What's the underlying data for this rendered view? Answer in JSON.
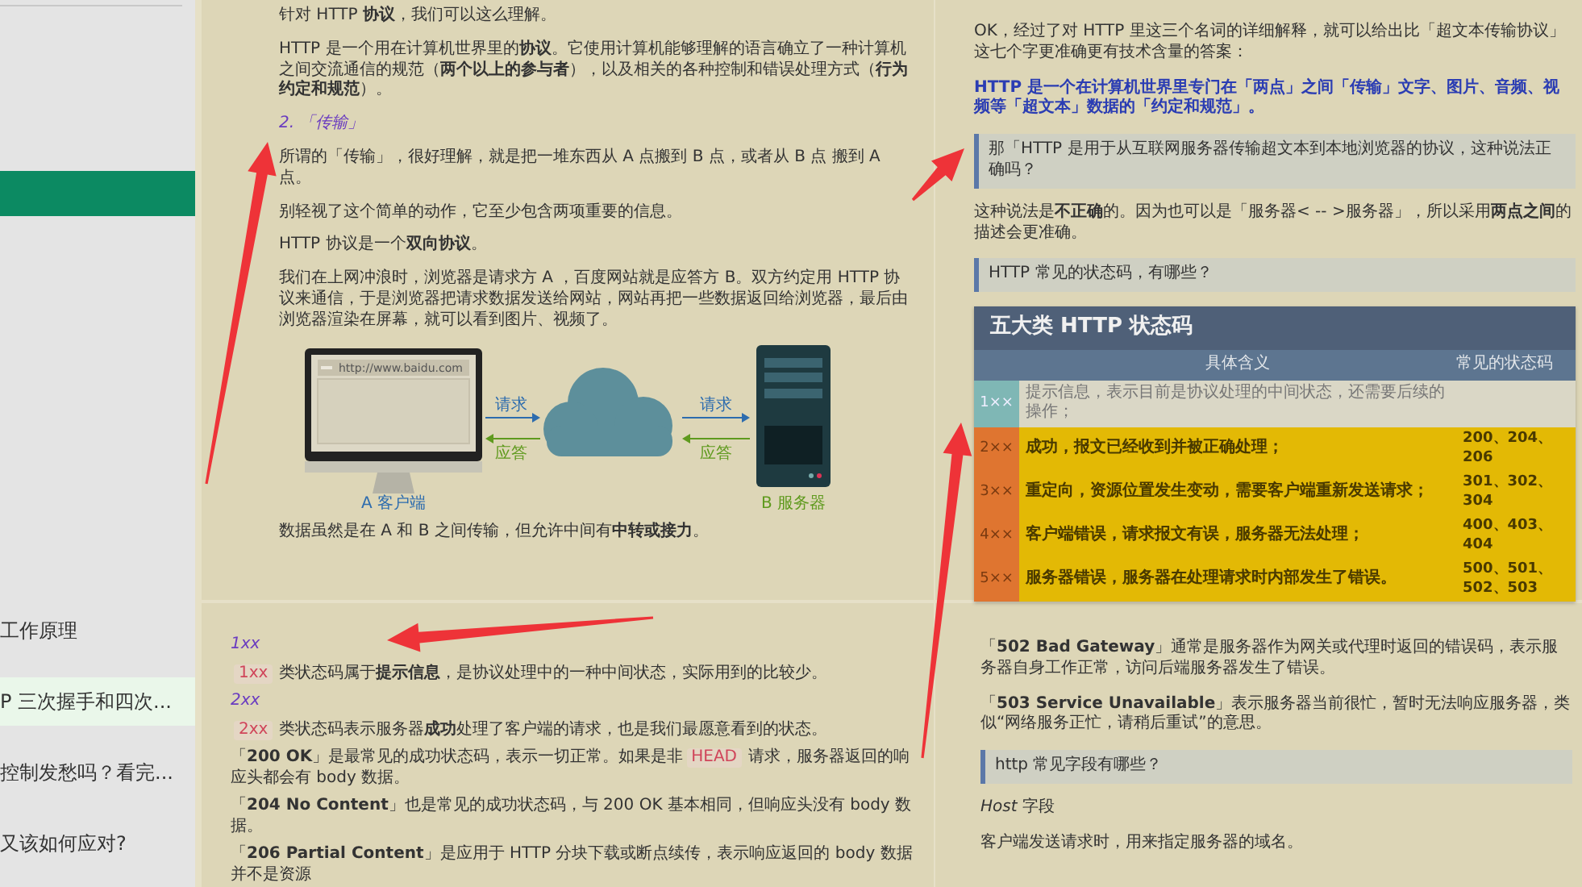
{
  "sidebar": {
    "items": [
      {
        "text": "工作原理",
        "selected": false
      },
      {
        "text": "P 三次握手和四次...",
        "selected": true
      },
      {
        "text": "控制发愁吗？看完...",
        "selected": false
      },
      {
        "text": "又该如何应对?",
        "selected": false
      }
    ]
  },
  "pages": [
    {
      "blocks": [
        {
          "kind": "paragraph",
          "text": "针对 HTTP **协议**，我们可以这么理解。"
        },
        {
          "kind": "paragraph",
          "text": "HTTP 是一个用在计算机世界里的**协议**。它使用计算机能够理解的语言确立了一种计算机之间交流通信的规范（**两个以上的参与者**），以及相关的各种控制和错误处理方式（**行为约定和规范**）。"
        },
        {
          "kind": "heading",
          "text": "2. 「传输」"
        },
        {
          "kind": "paragraph",
          "text": "所谓的「传输」，很好理解，就是把一堆东西从 A 点搬到 B 点，或者从 B 点 搬到 A 点。"
        },
        {
          "kind": "paragraph",
          "text": "别轻视了这个简单的动作，它至少包含两项重要的信息。"
        },
        {
          "kind": "paragraph",
          "text": "HTTP 协议是一个**双向协议**。"
        },
        {
          "kind": "paragraph",
          "text": "我们在上网冲浪时，浏览器是请求方 A ，百度网站就是应答方 B。双方约定用 HTTP 协议来通信，于是浏览器把请求数据发送给网站，网站再把一些数据返回给浏览器，最后由浏览器渲染在屏幕，就可以看到图片、视频了。"
        },
        {
          "kind": "figure",
          "url": "http://www.baidu.com",
          "links": [
            {
              "request": "请求",
              "response": "应答"
            },
            {
              "request": "请求",
              "response": "应答"
            }
          ],
          "client": "A 客户端",
          "server": "B 服务器"
        },
        {
          "kind": "paragraph",
          "text": "数据虽然是在 A 和 B 之间传输，但允许中间有**中转或接力**。"
        }
      ]
    },
    {
      "blocks": [
        {
          "kind": "paragraph",
          "text": "OK，经过了对 HTTP 里这三个名词的详细解释，就可以给出比「超文本传输协议」这七个字更准确更有技术含量的答案："
        },
        {
          "kind": "emphasis",
          "text": "HTTP 是一个在计算机世界里专门在「两点」之间「传输」文字、图片、音频、视频等「超文本」数据的「约定和规范」。"
        },
        {
          "kind": "quote",
          "text": "那「HTTP 是用于从互联网服务器传输超文本到本地浏览器的协议，这种说法正确吗？"
        },
        {
          "kind": "paragraph",
          "text": "这种说法是**不正确**的。因为也可以是「服务器< -- >服务器」，所以采用**两点之间**的描述会更准确。"
        },
        {
          "kind": "quote",
          "text": "HTTP 常见的状态码，有哪些？"
        },
        {
          "kind": "table",
          "title": "五大类 HTTP 状态码",
          "columns": [
            "具体含义",
            "常见的状态码"
          ],
          "rows": [
            {
              "kind": "info",
              "code": "1××",
              "meaning": "提示信息，表示目前是协议处理的中间状态，还需要后续的操作；"
            },
            {
              "kind": "main",
              "code": "2××",
              "meaning": "成功，报文已经收到并被正确处理；",
              "examples": "200、204、206"
            },
            {
              "kind": "main",
              "code": "3××",
              "meaning": "重定向，资源位置发生变动，需要客户端重新发送请求；",
              "examples": "301、302、304"
            },
            {
              "kind": "main",
              "code": "4××",
              "meaning": "客户端错误，请求报文有误，服务器无法处理；",
              "examples": "400、403、404"
            },
            {
              "kind": "main",
              "code": "5××",
              "meaning": "服务器错误，服务器在处理请求时内部发生了错误。",
              "examples": "500、501、502、503"
            }
          ]
        }
      ]
    },
    {
      "blocks": [
        {
          "kind": "heading",
          "text": "1xx"
        },
        {
          "kind": "paragraph",
          "parts": [
            {
              "kind": "code",
              "text": "1xx"
            },
            {
              "kind": "text",
              "text": "类状态码属于**提示信息**，是协议处理中的一种中间状态，实际用到的比较少。"
            }
          ]
        },
        {
          "kind": "heading",
          "text": "2xx"
        },
        {
          "kind": "paragraph",
          "parts": [
            {
              "kind": "code",
              "text": "2xx"
            },
            {
              "kind": "text",
              "text": "类状态码表示服务器**成功**处理了客户端的请求，也是我们最愿意看到的状态。"
            }
          ]
        },
        {
          "kind": "paragraph",
          "parts": [
            {
              "kind": "text",
              "text": "「**200 OK**」是最常见的成功状态码，表示一切正常。如果是非"
            },
            {
              "kind": "code",
              "text": "HEAD"
            },
            {
              "kind": "text",
              "text": "请求，服务器返回的响应头都会有 body 数据。"
            }
          ]
        },
        {
          "kind": "paragraph",
          "text": "「**204 No Content**」也是常见的成功状态码，与 200 OK 基本相同，但响应头没有 body 数据。"
        },
        {
          "kind": "paragraph",
          "text": "「**206 Partial Content**」是应用于 HTTP 分块下载或断点续传，表示响应返回的 body 数据并不是资源"
        }
      ]
    },
    {
      "blocks": [
        {
          "kind": "paragraph",
          "text": "「**502 Bad Gateway**」通常是服务器作为网关或代理时返回的错误码，表示服务器自身工作正常，访问后端服务器发生了错误。"
        },
        {
          "kind": "paragraph",
          "text": "「**503 Service Unavailable**」表示服务器当前很忙，暂时无法响应服务器，类似“网络服务正忙，请稍后重试”的意思。"
        },
        {
          "kind": "quote",
          "text": "http 常见字段有哪些？"
        },
        {
          "kind": "paragraph",
          "text": "*Host* 字段"
        },
        {
          "kind": "paragraph",
          "text": "客户端发送请求时，用来指定服务器的域名。"
        }
      ]
    }
  ]
}
